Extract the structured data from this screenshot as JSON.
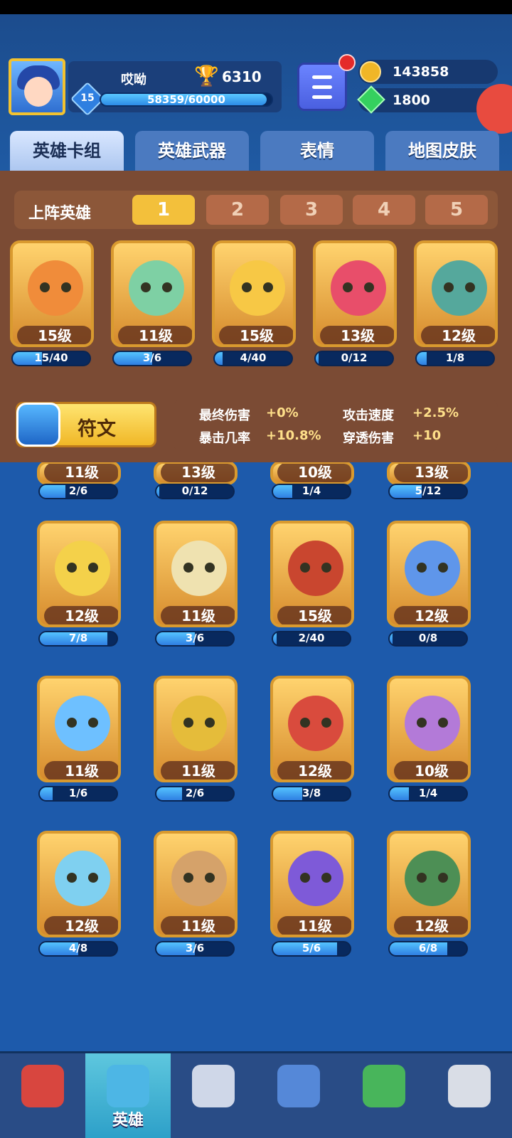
{
  "player": {
    "name": "哎呦",
    "trophies": "6310",
    "level": "15",
    "xp_text": "58359/60000",
    "xp_fraction": 0.9727
  },
  "currencies": {
    "gold": "143858",
    "gems": "1800"
  },
  "tabs": [
    "英雄卡组",
    "英雄武器",
    "表情",
    "地图皮肤"
  ],
  "deck": {
    "label": "上阵英雄",
    "slots": [
      "1",
      "2",
      "3",
      "4",
      "5"
    ],
    "active_slot": "1"
  },
  "deck_heroes": [
    {
      "level": "15级",
      "progress": "15/40",
      "fraction": 0.375,
      "color": "#f08c3a"
    },
    {
      "level": "11级",
      "progress": "3/6",
      "fraction": 0.5,
      "color": "#7ed0a4"
    },
    {
      "level": "15级",
      "progress": "4/40",
      "fraction": 0.1,
      "color": "#f7c845"
    },
    {
      "level": "13级",
      "progress": "0/12",
      "fraction": 0.0,
      "color": "#e84e6a"
    },
    {
      "level": "12级",
      "progress": "1/8",
      "fraction": 0.125,
      "color": "#55a89c"
    }
  ],
  "rune_button": "符文",
  "stats": [
    {
      "label": "最终伤害",
      "value": "+0%"
    },
    {
      "label": "攻击速度",
      "value": "+2.5%"
    },
    {
      "label": "暴击几率",
      "value": "+10.8%"
    },
    {
      "label": "穿透伤害",
      "value": "+10"
    }
  ],
  "collection_rows": [
    [
      {
        "level": "11级",
        "progress": "2/6",
        "fraction": 0.333,
        "color": "#f0b84c"
      },
      {
        "level": "13级",
        "progress": "0/12",
        "fraction": 0.0,
        "color": "#f0b84c"
      },
      {
        "level": "10级",
        "progress": "1/4",
        "fraction": 0.25,
        "color": "#f0b84c"
      },
      {
        "level": "13级",
        "progress": "5/12",
        "fraction": 0.417,
        "color": "#f0b84c"
      }
    ],
    [
      {
        "level": "12级",
        "progress": "7/8",
        "fraction": 0.875,
        "color": "#f4d14a"
      },
      {
        "level": "11级",
        "progress": "3/6",
        "fraction": 0.5,
        "color": "#efe2b0"
      },
      {
        "level": "15级",
        "progress": "2/40",
        "fraction": 0.05,
        "color": "#c9462f"
      },
      {
        "level": "12级",
        "progress": "0/8",
        "fraction": 0.0,
        "color": "#5f96ea"
      }
    ],
    [
      {
        "level": "11级",
        "progress": "1/6",
        "fraction": 0.167,
        "color": "#6ec0ff"
      },
      {
        "level": "11级",
        "progress": "2/6",
        "fraction": 0.333,
        "color": "#e5bc3a"
      },
      {
        "level": "12级",
        "progress": "3/8",
        "fraction": 0.375,
        "color": "#d94b3d"
      },
      {
        "level": "10级",
        "progress": "1/4",
        "fraction": 0.25,
        "color": "#b37ad8"
      }
    ],
    [
      {
        "level": "12级",
        "progress": "4/8",
        "fraction": 0.5,
        "color": "#7fd0f0"
      },
      {
        "level": "11级",
        "progress": "3/6",
        "fraction": 0.5,
        "color": "#d5a26a"
      },
      {
        "level": "11级",
        "progress": "5/6",
        "fraction": 0.833,
        "color": "#7e5ad8"
      },
      {
        "level": "12级",
        "progress": "6/8",
        "fraction": 0.75,
        "color": "#4d8f55"
      }
    ]
  ],
  "bottom_nav": [
    {
      "name": "shield-trophy-icon",
      "label": ""
    },
    {
      "name": "hero-chest-icon",
      "label": "英雄"
    },
    {
      "name": "crossed-swords-icon",
      "label": ""
    },
    {
      "name": "team-cards-icon",
      "label": ""
    },
    {
      "name": "sprout-block-icon",
      "label": ""
    },
    {
      "name": "knight-helmet-icon",
      "label": ""
    }
  ]
}
